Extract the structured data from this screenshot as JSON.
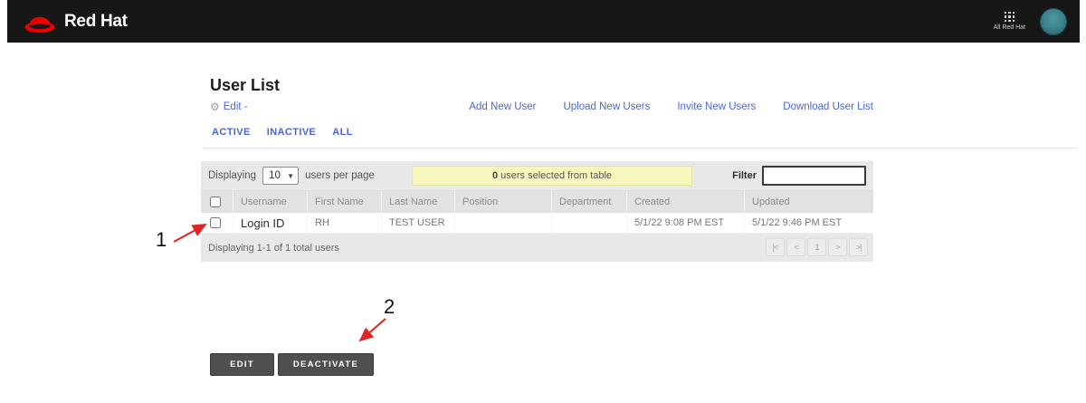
{
  "header": {
    "brand": "Red Hat",
    "app_switcher": "All Red Hat"
  },
  "page": {
    "title": "User List",
    "edit_link": "Edit -",
    "tabs": [
      {
        "label": "ACTIVE"
      },
      {
        "label": "INACTIVE"
      },
      {
        "label": "ALL"
      }
    ],
    "actions": [
      {
        "label": "Add New User"
      },
      {
        "label": "Upload New Users"
      },
      {
        "label": "Invite New Users"
      },
      {
        "label": "Download User List"
      }
    ]
  },
  "controls": {
    "displaying_label": "Displaying",
    "per_page": "10",
    "per_page_suffix": "users per page",
    "selected_count": "0",
    "selected_suffix": " users selected from table",
    "filter_label": "Filter",
    "filter_value": ""
  },
  "table": {
    "columns": [
      "Username",
      "First Name",
      "Last Name",
      "Position",
      "Department",
      "Created",
      "Updated"
    ],
    "rows": [
      {
        "username": "Login ID",
        "first_name": "RH",
        "last_name": "TEST USER",
        "position": "",
        "department": "",
        "created": "5/1/22 9:08 PM EST",
        "updated": "5/1/22 9:46 PM EST"
      }
    ],
    "footer": "Displaying 1-1 of 1 total users",
    "pagination": {
      "first": "|<",
      "prev": "<",
      "current": "1",
      "next": ">",
      "last": ">|"
    }
  },
  "action_buttons": {
    "edit": "EDIT",
    "deactivate": "DEACTIVATE"
  },
  "annotations": {
    "one": "1",
    "two": "2"
  },
  "colors": {
    "brand-red": "#ee0000",
    "link-blue": "#4a66d9",
    "annotation-red": "#e02424",
    "selected-yellow": "#f7f7bd",
    "header-black": "#171717",
    "button-gray": "#4f4f4f"
  }
}
